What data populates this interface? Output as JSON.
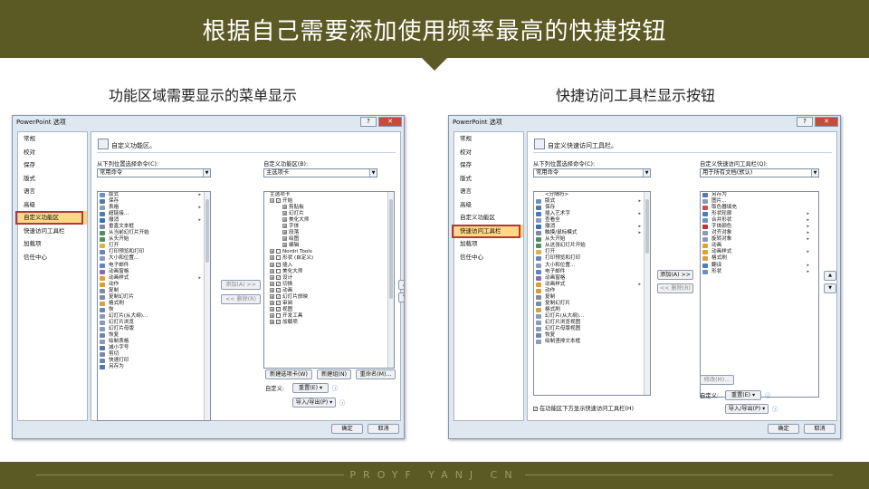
{
  "slide": {
    "title": "根据自己需要添加使用频率最高的快捷按钮",
    "left_caption": "功能区域需要显示的菜单显示",
    "right_caption": "快捷访问工具栏显示按钮",
    "footer": "PROYF YANJ CN",
    "colors": {
      "bar": "#5c5a24",
      "highlight": "#b83737",
      "selected": "#fbd985"
    }
  },
  "left_dialog": {
    "title": "PowerPoint 选项",
    "title_buttons": [
      "?",
      "✕"
    ],
    "nav": [
      "常规",
      "校对",
      "保存",
      "版式",
      "语言",
      "高级",
      "自定义功能区",
      "快速访问工具栏",
      "加载项",
      "信任中心"
    ],
    "selected_nav": "自定义功能区",
    "header": "自定义功能区。",
    "choose_label": "从下列位置选择命令(C):",
    "choose_value": "常用命令",
    "customize_label": "自定义功能区(B):",
    "customize_value": "主选项卡",
    "commands": [
      {
        "t": "版式",
        "i": "#6b8fc8",
        "a": "▸"
      },
      {
        "t": "保存",
        "i": "#5577aa",
        "a": ""
      },
      {
        "t": "表格",
        "i": "#8a9ab8",
        "a": "▸"
      },
      {
        "t": "超链接...",
        "i": "#4a7dc0",
        "a": ""
      },
      {
        "t": "撤消",
        "i": "#3a70b5",
        "a": "▸"
      },
      {
        "t": "垂直文本框",
        "i": "#7c8aa8",
        "a": ""
      },
      {
        "t": "从当前幻灯片开始",
        "i": "#4f8f5c",
        "a": ""
      },
      {
        "t": "从头开始",
        "i": "#4f8f5c",
        "a": ""
      },
      {
        "t": "打开",
        "i": "#d8b24a",
        "a": ""
      },
      {
        "t": "打印预览和打印",
        "i": "#6b86b6",
        "a": ""
      },
      {
        "t": "大小和位置...",
        "i": "#8a9ab8",
        "a": ""
      },
      {
        "t": "电子邮件",
        "i": "#5c86c4",
        "a": ""
      },
      {
        "t": "动画窗格",
        "i": "#8a6ab8",
        "a": ""
      },
      {
        "t": "动画样式",
        "i": "#e0a030",
        "a": "▸"
      },
      {
        "t": "动作",
        "i": "#d8a030",
        "a": ""
      },
      {
        "t": "复制",
        "i": "#7c8aa8",
        "a": ""
      },
      {
        "t": "复制幻灯片",
        "i": "#7c8aa8",
        "a": ""
      },
      {
        "t": "格式刷",
        "i": "#d8a040",
        "a": ""
      },
      {
        "t": "恢",
        "i": "#6b86b6",
        "a": ""
      },
      {
        "t": "幻灯片(从大纲)...",
        "i": "#8a9ab8",
        "a": ""
      },
      {
        "t": "幻灯片浏览",
        "i": "#8a9ab8",
        "a": ""
      },
      {
        "t": "幻灯片母版",
        "i": "#8a9ab8",
        "a": ""
      },
      {
        "t": "恢复",
        "i": "#6b86b6",
        "a": ""
      },
      {
        "t": "绘制表格",
        "i": "#8a9ab8",
        "a": ""
      },
      {
        "t": "减小字号",
        "i": "#5577aa",
        "a": ""
      },
      {
        "t": "剪切",
        "i": "#7c8aa8",
        "a": ""
      },
      {
        "t": "快速打印",
        "i": "#6b86b6",
        "a": ""
      },
      {
        "t": "另存为",
        "i": "#5577aa",
        "a": ""
      }
    ],
    "add_btn": "添加(A) >>",
    "remove_btn": "<< 删除(R)",
    "tree": [
      {
        "t": "主选项卡",
        "lvl": 0,
        "cb": false,
        "ex": ""
      },
      {
        "t": "开始",
        "lvl": 0,
        "cb": true,
        "ex": "⊟"
      },
      {
        "t": "剪贴板",
        "lvl": 1,
        "cb": false,
        "ex": "⊞"
      },
      {
        "t": "幻灯片",
        "lvl": 1,
        "cb": false,
        "ex": "⊞"
      },
      {
        "t": "美化大师",
        "lvl": 1,
        "cb": false,
        "ex": "⊞"
      },
      {
        "t": "字体",
        "lvl": 1,
        "cb": false,
        "ex": "⊞"
      },
      {
        "t": "段落",
        "lvl": 1,
        "cb": false,
        "ex": "⊞"
      },
      {
        "t": "绘图",
        "lvl": 1,
        "cb": false,
        "ex": "⊞"
      },
      {
        "t": "编辑",
        "lvl": 1,
        "cb": false,
        "ex": "⊞"
      },
      {
        "t": "Nordri Tools",
        "lvl": 0,
        "cb": false,
        "ex": "⊞"
      },
      {
        "t": "形状 (自定义)",
        "lvl": 0,
        "cb": false,
        "ex": "⊞"
      },
      {
        "t": "插入",
        "lvl": 0,
        "cb": true,
        "ex": "⊞"
      },
      {
        "t": "美化大师",
        "lvl": 0,
        "cb": false,
        "ex": "⊞"
      },
      {
        "t": "设计",
        "lvl": 0,
        "cb": true,
        "ex": "⊞"
      },
      {
        "t": "切换",
        "lvl": 0,
        "cb": true,
        "ex": "⊞"
      },
      {
        "t": "动画",
        "lvl": 0,
        "cb": true,
        "ex": "⊞"
      },
      {
        "t": "幻灯片放映",
        "lvl": 0,
        "cb": true,
        "ex": "⊞"
      },
      {
        "t": "审阅",
        "lvl": 0,
        "cb": true,
        "ex": "⊞"
      },
      {
        "t": "视图",
        "lvl": 0,
        "cb": true,
        "ex": "⊞"
      },
      {
        "t": "开发工具",
        "lvl": 0,
        "cb": false,
        "ex": "⊞"
      },
      {
        "t": "加载项",
        "lvl": 0,
        "cb": true,
        "ex": "⊞"
      }
    ],
    "new_tab_btn": "新建选项卡(W)",
    "new_group_btn": "新建组(N)",
    "rename_btn": "重命名(M)...",
    "custom_label": "自定义:",
    "reset_btn": "重置(E) ▾",
    "import_btn": "导入/导出(P) ▾",
    "ok_btn": "确定",
    "cancel_btn": "取消"
  },
  "right_dialog": {
    "title": "PowerPoint 选项",
    "title_buttons": [
      "?",
      "✕"
    ],
    "nav": [
      "常规",
      "校对",
      "保存",
      "版式",
      "语言",
      "高级",
      "自定义功能区",
      "快速访问工具栏",
      "加载项",
      "信任中心"
    ],
    "selected_nav": "快速访问工具栏",
    "header": "自定义快速访问工具栏。",
    "choose_label": "从下列位置选择命令(C):",
    "choose_value": "常用命令",
    "customize_label": "自定义快速访问工具栏(Q):",
    "customize_value": "用于所有文档(默认)",
    "commands": [
      {
        "t": "<分隔符>",
        "i": "",
        "a": ""
      },
      {
        "t": "版式",
        "i": "#6b8fc8",
        "a": "▸"
      },
      {
        "t": "保存",
        "i": "#5577aa",
        "a": ""
      },
      {
        "t": "插入艺术字",
        "i": "#4a7dc0",
        "a": "▸"
      },
      {
        "t": "查看全",
        "i": "#8a9ab8",
        "a": ""
      },
      {
        "t": "撤消",
        "i": "#3a70b5",
        "a": "▸"
      },
      {
        "t": "触摸/鼠标模式",
        "i": "#7c8aa8",
        "a": "▸"
      },
      {
        "t": "从头开始",
        "i": "#4f8f5c",
        "a": ""
      },
      {
        "t": "从这张幻灯片开始",
        "i": "#4f8f5c",
        "a": ""
      },
      {
        "t": "打开",
        "i": "#d8b24a",
        "a": ""
      },
      {
        "t": "打印预览和打印",
        "i": "#6b86b6",
        "a": ""
      },
      {
        "t": "大小和位置...",
        "i": "#8a9ab8",
        "a": ""
      },
      {
        "t": "电子邮件",
        "i": "#5c86c4",
        "a": ""
      },
      {
        "t": "动画窗格",
        "i": "#8a6ab8",
        "a": ""
      },
      {
        "t": "动画样式",
        "i": "#e0a030",
        "a": "▸"
      },
      {
        "t": "动作",
        "i": "#d8a030",
        "a": ""
      },
      {
        "t": "复制",
        "i": "#7c8aa8",
        "a": ""
      },
      {
        "t": "复制幻灯片",
        "i": "#7c8aa8",
        "a": ""
      },
      {
        "t": "格式刷",
        "i": "#d8a040",
        "a": ""
      },
      {
        "t": "幻灯片(从大纲)...",
        "i": "#8a9ab8",
        "a": ""
      },
      {
        "t": "幻灯片浏览视图",
        "i": "#8a9ab8",
        "a": ""
      },
      {
        "t": "幻灯片母版视图",
        "i": "#8a9ab8",
        "a": ""
      },
      {
        "t": "恢复",
        "i": "#6b86b6",
        "a": ""
      },
      {
        "t": "绘制竖排文本框",
        "i": "#8a9ab8",
        "a": ""
      }
    ],
    "qat_items": [
      {
        "t": "另存为",
        "i": "#5577aa",
        "a": ""
      },
      {
        "t": "图片...",
        "i": "#8a9ab8",
        "a": ""
      },
      {
        "t": "取色器填充",
        "i": "#d84a4a",
        "a": ""
      },
      {
        "t": "形状轮廓",
        "i": "#4a7dc0",
        "a": "▸"
      },
      {
        "t": "合并形状",
        "i": "#6b8fc8",
        "a": "▸"
      },
      {
        "t": "字体颜色",
        "i": "#c83030",
        "a": "▸"
      },
      {
        "t": "对齐对象",
        "i": "#8a9ab8",
        "a": "▸"
      },
      {
        "t": "旋转对象",
        "i": "#8a9ab8",
        "a": "▸"
      },
      {
        "t": "动画",
        "i": "#e0a030",
        "a": ""
      },
      {
        "t": "动画样式",
        "i": "#e0a030",
        "a": "▸"
      },
      {
        "t": "格式刷",
        "i": "#d8a040",
        "a": ""
      },
      {
        "t": "翻译",
        "i": "#4a7dc0",
        "a": "▸"
      },
      {
        "t": "形状",
        "i": "#6b8fc8",
        "a": "▸"
      }
    ],
    "add_btn": "添加(A) >>",
    "remove_btn": "<< 删除(R)",
    "modify_btn": "修改(M)...",
    "custom_label": "自定义:",
    "reset_btn": "重置(E) ▾",
    "import_btn": "导入/导出(P) ▾",
    "show_below_label": "在功能区下方显示快速访问工具栏(H)",
    "ok_btn": "确定",
    "cancel_btn": "取消"
  }
}
